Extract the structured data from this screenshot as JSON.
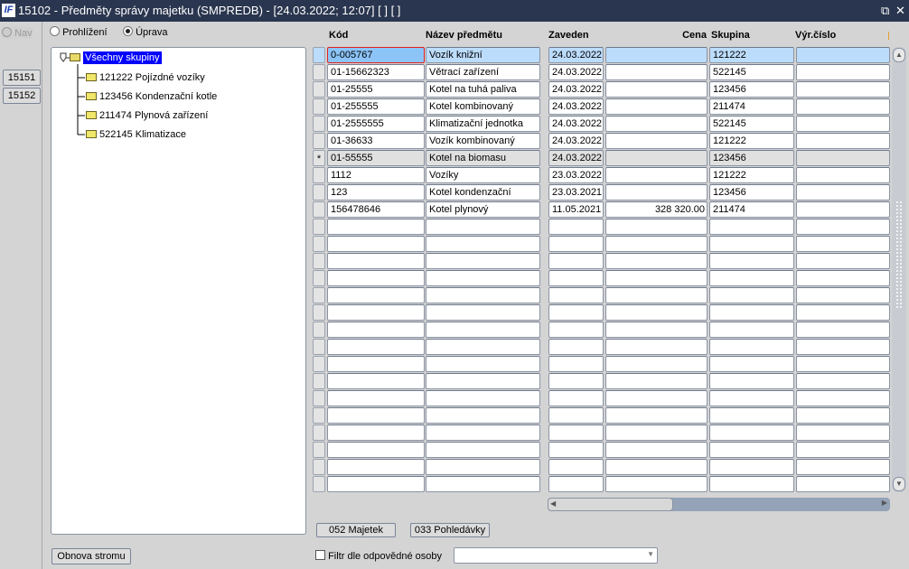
{
  "window": {
    "title": "15102 - Předměty správy majetku (SMPREDB) - [24.03.2022; 12:07]  [ ]  [ ]",
    "logo": "IF",
    "restore_icon": "restore-icon",
    "close_icon": "close-icon"
  },
  "left": {
    "nav_label": "Nav",
    "buttons": [
      "15151",
      "15152"
    ]
  },
  "mode": {
    "view_label": "Prohlížení",
    "edit_label": "Úprava",
    "selected": "edit"
  },
  "tree": {
    "root": "Všechny skupiny",
    "children": [
      "121222 Pojízdné vozíky",
      "123456 Kondenzační kotle",
      "211474 Plynová zařízení",
      "522145 Klimatizace"
    ]
  },
  "refresh_button": "Obnova stromu",
  "table": {
    "headers": {
      "kod": "Kód",
      "nazev": "Název předmětu",
      "zaveden": "Zaveden",
      "cena": "Cena",
      "skupina": "Skupina",
      "vyr": "Výr.číslo"
    },
    "rows": [
      {
        "kod": "0-005767",
        "nazev": "Vozík knižní",
        "zaveden": "24.03.2022",
        "cena": "",
        "skupina": "121222",
        "vyr": "",
        "state": "selected"
      },
      {
        "kod": "01-15662323",
        "nazev": "Větrací zařízení",
        "zaveden": "24.03.2022",
        "cena": "",
        "skupina": "522145",
        "vyr": ""
      },
      {
        "kod": "01-25555",
        "nazev": "Kotel na tuhá paliva",
        "zaveden": "24.03.2022",
        "cena": "",
        "skupina": "123456",
        "vyr": ""
      },
      {
        "kod": "01-255555",
        "nazev": "Kotel kombinovaný",
        "zaveden": "24.03.2022",
        "cena": "",
        "skupina": "211474",
        "vyr": ""
      },
      {
        "kod": "01-2555555",
        "nazev": "Klimatizační jednotka",
        "zaveden": "24.03.2022",
        "cena": "",
        "skupina": "522145",
        "vyr": ""
      },
      {
        "kod": "01-36633",
        "nazev": "Vozík kombinovaný",
        "zaveden": "24.03.2022",
        "cena": "",
        "skupina": "121222",
        "vyr": ""
      },
      {
        "kod": "01-55555",
        "nazev": "Kotel na biomasu",
        "zaveden": "24.03.2022",
        "cena": "",
        "skupina": "123456",
        "vyr": "",
        "state": "current",
        "marker": "*"
      },
      {
        "kod": "1112",
        "nazev": "Vozíky",
        "zaveden": "23.03.2022",
        "cena": "",
        "skupina": "121222",
        "vyr": ""
      },
      {
        "kod": "123",
        "nazev": "Kotel kondenzační",
        "zaveden": "23.03.2021",
        "cena": "",
        "skupina": "123456",
        "vyr": ""
      },
      {
        "kod": "156478646",
        "nazev": "Kotel plynový",
        "zaveden": "11.05.2021",
        "cena": "328 320.00",
        "skupina": "211474",
        "vyr": ""
      }
    ],
    "total_visible_rows": 26
  },
  "actions": {
    "majetek": "052 Majetek",
    "pohledavky": "033 Pohledávky"
  },
  "filter": {
    "label": "Filtr dle odpovědné osoby",
    "checked": false,
    "value": ""
  },
  "colors": {
    "selected_row": "#bcdcfb",
    "current_row": "#e0e0e0",
    "focus_border": "#e02020",
    "tree_selection": "#0000ff"
  }
}
